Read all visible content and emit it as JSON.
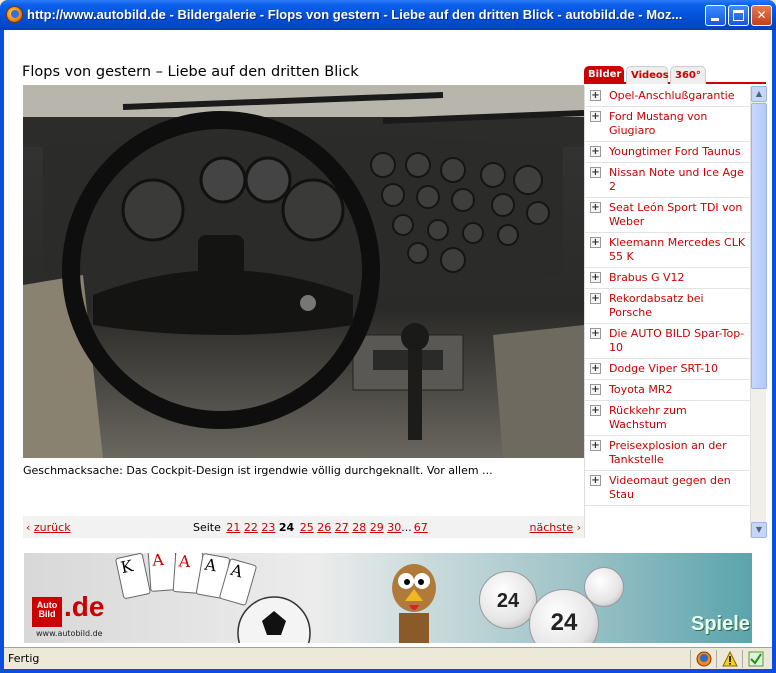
{
  "window": {
    "title": "http://www.autobild.de - Bildergalerie - Flops von gestern - Liebe auf den dritten Blick - autobild.de - Moz...",
    "minimize_icon": "minimize-icon",
    "maximize_icon": "maximize-icon",
    "close_icon": "close-icon"
  },
  "page": {
    "title": "Flops von gestern – Liebe auf den dritten Blick",
    "caption": "Geschmacksache: Das Cockpit-Design ist irgendwie völlig durchgeknallt. Vor allem ..."
  },
  "pager": {
    "prev_label": "zurück",
    "next_label": "nächste",
    "seite_label": "Seite",
    "pages_before": [
      "21",
      "22",
      "23"
    ],
    "current": "24",
    "pages_after": [
      "25",
      "26",
      "27",
      "28",
      "29",
      "30"
    ],
    "ellipsis": "...",
    "last": "67"
  },
  "tabs": [
    {
      "label": "Bilder",
      "active": true
    },
    {
      "label": "Videos",
      "active": false
    },
    {
      "label": "360°",
      "active": false
    }
  ],
  "sidebar": {
    "items": [
      {
        "label": "Opel-Anschlußgarantie"
      },
      {
        "label": "Ford Mustang von Giugiaro"
      },
      {
        "label": "Youngtimer Ford Taunus"
      },
      {
        "label": "Nissan Note und Ice Age 2"
      },
      {
        "label": "Seat León Sport TDI von Weber"
      },
      {
        "label": "Kleemann Mercedes CLK 55 K"
      },
      {
        "label": "Brabus G V12"
      },
      {
        "label": "Rekordabsatz bei Porsche"
      },
      {
        "label": "Die AUTO BILD Spar-Top-10"
      },
      {
        "label": "Dodge Viper SRT-10"
      },
      {
        "label": "Toyota MR2"
      },
      {
        "label": "Rückkehr zum Wachstum"
      },
      {
        "label": "Preisexplosion an der Tankstelle"
      },
      {
        "label": "Videomaut gegen den Stau"
      }
    ]
  },
  "banner": {
    "logo_text": "Auto Bild",
    "logo_suffix": ".de",
    "logo_url": "www.autobild.de",
    "brand_text": "Spiele",
    "card_labels": [
      "K",
      "A",
      "A",
      "A",
      "A"
    ],
    "ball_numbers": [
      "24",
      "24"
    ]
  },
  "status": {
    "text": "Fertig"
  },
  "colors": {
    "accent": "#cc0000",
    "titlebar": "#0a5fe8"
  }
}
